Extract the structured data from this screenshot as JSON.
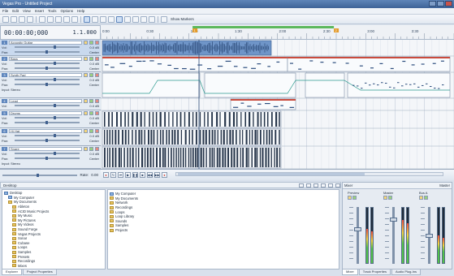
{
  "window": {
    "title": "Vegas Pro - Untitled Project"
  },
  "menu": [
    "File",
    "Edit",
    "View",
    "Insert",
    "Tools",
    "Options",
    "Help"
  ],
  "toolbar": {
    "label": "Show Markers"
  },
  "time": {
    "timecode": "00:00:00;000",
    "bars_beats": "1.1.000"
  },
  "ruler": {
    "labels": [
      "0:00",
      "0:30",
      "1:00",
      "1:30",
      "2:00",
      "2:30",
      "3:00",
      "3:30",
      "4:00"
    ],
    "markers": [
      "1",
      "2"
    ],
    "loop_fraction": [
      0.26,
      0.66
    ]
  },
  "tracks": [
    {
      "num": "1",
      "name": "Acoustic Guitar",
      "vol": "Vol:",
      "vol_value": "0.0 dB",
      "pan": "Pan:",
      "pan_value": "Center",
      "extra": "Input: Stereo",
      "type": "wave",
      "selected": true
    },
    {
      "num": "2",
      "name": "Bass",
      "vol": "Vol:",
      "vol_value": "0.0 dB",
      "pan": "Pan:",
      "pan_value": "Center",
      "extra": "Input: Stereo",
      "type": "midi"
    },
    {
      "num": "3",
      "name": "Synth Pad",
      "vol": "Vol:",
      "vol_value": "0.0 dB",
      "pan": "Pan:",
      "pan_value": "Center",
      "extra": "Input: Stereo",
      "type": "automation"
    },
    {
      "num": "4",
      "name": "Lead",
      "vol": "Vol:",
      "vol_value": "0.0 dB",
      "pan": "Pan:",
      "pan_value": "Center",
      "extra": "Input: Stereo",
      "type": "midi2"
    },
    {
      "num": "5",
      "name": "Drums",
      "vol": "Vol:",
      "vol_value": "0.0 dB",
      "pan": "Pan:",
      "pan_value": "Center",
      "extra": "Input: Stereo",
      "type": "dense"
    },
    {
      "num": "6",
      "name": "Hi Hat",
      "vol": "Vol:",
      "vol_value": "0.0 dB",
      "pan": "Pan:",
      "pan_value": "Center",
      "extra": "Input: Stereo",
      "type": "dense2"
    },
    {
      "num": "7",
      "name": "Snare",
      "vol": "Vol:",
      "vol_value": "0.0 dB",
      "pan": "Pan:",
      "pan_value": "Center",
      "extra": "Input: Stereo",
      "type": "dense3"
    }
  ],
  "transport": {
    "rate_label": "Rate:",
    "rate_value": "0.00",
    "buttons": [
      "rec",
      "loop",
      "play-start",
      "play",
      "pause",
      "stop",
      "prev",
      "next"
    ]
  },
  "explorer": {
    "path": "Desktop",
    "tree": [
      {
        "name": "Desktop",
        "level": 0,
        "kind": "pc"
      },
      {
        "name": "My Computer",
        "level": 1,
        "kind": "pc"
      },
      {
        "name": "My Documents",
        "level": 1,
        "kind": "folder"
      },
      {
        "name": "Ableton",
        "level": 2,
        "kind": "folder"
      },
      {
        "name": "ACID Music Projects",
        "level": 2,
        "kind": "folder"
      },
      {
        "name": "My Music",
        "level": 2,
        "kind": "folder"
      },
      {
        "name": "My Pictures",
        "level": 2,
        "kind": "folder"
      },
      {
        "name": "My Videos",
        "level": 2,
        "kind": "folder"
      },
      {
        "name": "Sound Forge",
        "level": 2,
        "kind": "folder"
      },
      {
        "name": "Vegas Projects",
        "level": 2,
        "kind": "folder"
      },
      {
        "name": "Sonar",
        "level": 2,
        "kind": "folder"
      },
      {
        "name": "Cubase",
        "level": 2,
        "kind": "folder"
      },
      {
        "name": "Loops",
        "level": 2,
        "kind": "folder"
      },
      {
        "name": "Samples",
        "level": 2,
        "kind": "folder"
      },
      {
        "name": "Presets",
        "level": 2,
        "kind": "folder"
      },
      {
        "name": "Recordings",
        "level": 2,
        "kind": "folder"
      },
      {
        "name": "Mixes",
        "level": 2,
        "kind": "folder"
      }
    ],
    "files": [
      {
        "name": "My Computer",
        "kind": "pc"
      },
      {
        "name": "My Documents",
        "kind": "folder"
      },
      {
        "name": "Network",
        "kind": "folder"
      },
      {
        "name": "Recordings",
        "kind": "folder"
      },
      {
        "name": "Loops",
        "kind": "folder"
      },
      {
        "name": "Loop Library",
        "kind": "folder"
      },
      {
        "name": "Sounds",
        "kind": "folder"
      },
      {
        "name": "Samples",
        "kind": "folder"
      },
      {
        "name": "Projects",
        "kind": "folder"
      }
    ],
    "tabs": [
      "Explorer",
      "Project Properties"
    ]
  },
  "mixer": {
    "title": "Mixer",
    "right_label": "Master",
    "strips": [
      {
        "name": "Preview",
        "level": 0.62
      },
      {
        "name": "Master",
        "level": 0.78
      },
      {
        "name": "Bus A",
        "level": 0.5
      }
    ],
    "tabs": [
      "Mixer",
      "Track Properties",
      "Audio Plug-Ins"
    ]
  }
}
